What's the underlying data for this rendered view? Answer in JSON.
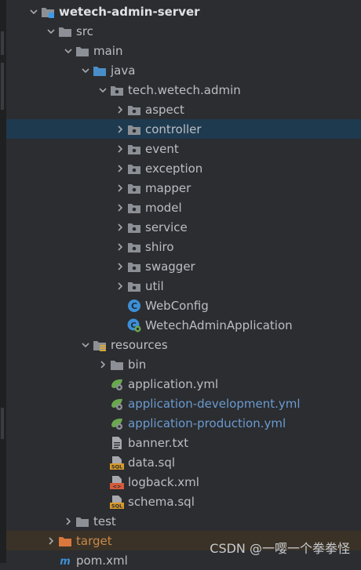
{
  "tree": [
    {
      "label": "wetech-admin-server",
      "depth": 0,
      "arrow": "down",
      "icon": "module-folder-icon",
      "bold": true
    },
    {
      "label": "src",
      "depth": 1,
      "arrow": "down",
      "icon": "folder-icon"
    },
    {
      "label": "main",
      "depth": 2,
      "arrow": "down",
      "icon": "folder-icon"
    },
    {
      "label": "java",
      "depth": 3,
      "arrow": "down",
      "icon": "source-folder-icon"
    },
    {
      "label": "tech.wetech.admin",
      "depth": 4,
      "arrow": "down",
      "icon": "package-icon"
    },
    {
      "label": "aspect",
      "depth": 5,
      "arrow": "right",
      "icon": "package-icon"
    },
    {
      "label": "controller",
      "depth": 5,
      "arrow": "right",
      "icon": "package-icon",
      "selected": true
    },
    {
      "label": "event",
      "depth": 5,
      "arrow": "right",
      "icon": "package-icon"
    },
    {
      "label": "exception",
      "depth": 5,
      "arrow": "right",
      "icon": "package-icon"
    },
    {
      "label": "mapper",
      "depth": 5,
      "arrow": "right",
      "icon": "package-icon"
    },
    {
      "label": "model",
      "depth": 5,
      "arrow": "right",
      "icon": "package-icon"
    },
    {
      "label": "service",
      "depth": 5,
      "arrow": "right",
      "icon": "package-icon"
    },
    {
      "label": "shiro",
      "depth": 5,
      "arrow": "right",
      "icon": "package-icon"
    },
    {
      "label": "swagger",
      "depth": 5,
      "arrow": "right",
      "icon": "package-icon"
    },
    {
      "label": "util",
      "depth": 5,
      "arrow": "right",
      "icon": "package-icon"
    },
    {
      "label": "WebConfig",
      "depth": 5,
      "arrow": "none",
      "icon": "java-class-icon"
    },
    {
      "label": "WetechAdminApplication",
      "depth": 5,
      "arrow": "none",
      "icon": "spring-boot-class-icon"
    },
    {
      "label": "resources",
      "depth": 3,
      "arrow": "down",
      "icon": "resources-folder-icon"
    },
    {
      "label": "bin",
      "depth": 4,
      "arrow": "right",
      "icon": "folder-icon"
    },
    {
      "label": "application.yml",
      "depth": 4,
      "arrow": "none",
      "icon": "spring-yml-icon"
    },
    {
      "label": "application-development.yml",
      "depth": 4,
      "arrow": "none",
      "icon": "spring-yml-icon",
      "color": "blue"
    },
    {
      "label": "application-production.yml",
      "depth": 4,
      "arrow": "none",
      "icon": "spring-yml-icon",
      "color": "blue"
    },
    {
      "label": "banner.txt",
      "depth": 4,
      "arrow": "none",
      "icon": "text-file-icon"
    },
    {
      "label": "data.sql",
      "depth": 4,
      "arrow": "none",
      "icon": "sql-file-icon"
    },
    {
      "label": "logback.xml",
      "depth": 4,
      "arrow": "none",
      "icon": "xml-file-icon"
    },
    {
      "label": "schema.sql",
      "depth": 4,
      "arrow": "none",
      "icon": "sql-file-icon"
    },
    {
      "label": "test",
      "depth": 2,
      "arrow": "right",
      "icon": "folder-icon"
    },
    {
      "label": "target",
      "depth": 1,
      "arrow": "right",
      "icon": "excluded-folder-icon",
      "color": "orange",
      "faint": true
    },
    {
      "label": "pom.xml",
      "depth": 1,
      "arrow": "none",
      "icon": "maven-icon"
    }
  ],
  "colors": {
    "background": "#2b2d30",
    "selected": "#1e3a4f",
    "folder": "#8c9096",
    "package": "#8c9096",
    "source": "#4a8ec9",
    "excluded": "#d9773d",
    "class": "#3d8fd6",
    "spring": "#6aa84f"
  },
  "watermark": "CSDN @一嘤一个拳拳怪"
}
